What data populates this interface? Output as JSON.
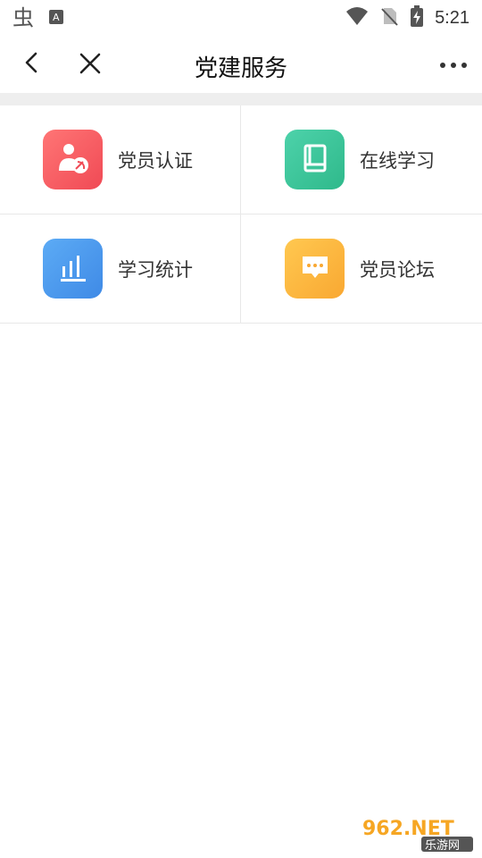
{
  "status_bar": {
    "time": "5:21"
  },
  "header": {
    "title": "党建服务"
  },
  "grid": {
    "items": [
      {
        "label": "党员认证",
        "icon": "party-member-icon",
        "color_start": "#ff6f6f",
        "color_end": "#f04a55"
      },
      {
        "label": "在线学习",
        "icon": "book-icon",
        "color_start": "#48d0a6",
        "color_end": "#2fb98b"
      },
      {
        "label": "学习统计",
        "icon": "bar-chart-icon",
        "color_start": "#58a8f4",
        "color_end": "#3f8ae6"
      },
      {
        "label": "党员论坛",
        "icon": "chat-bubble-icon",
        "color_start": "#ffc44a",
        "color_end": "#f9a832"
      }
    ]
  },
  "watermark": {
    "text_top": "962.NET",
    "text_bottom": "乐游网"
  }
}
